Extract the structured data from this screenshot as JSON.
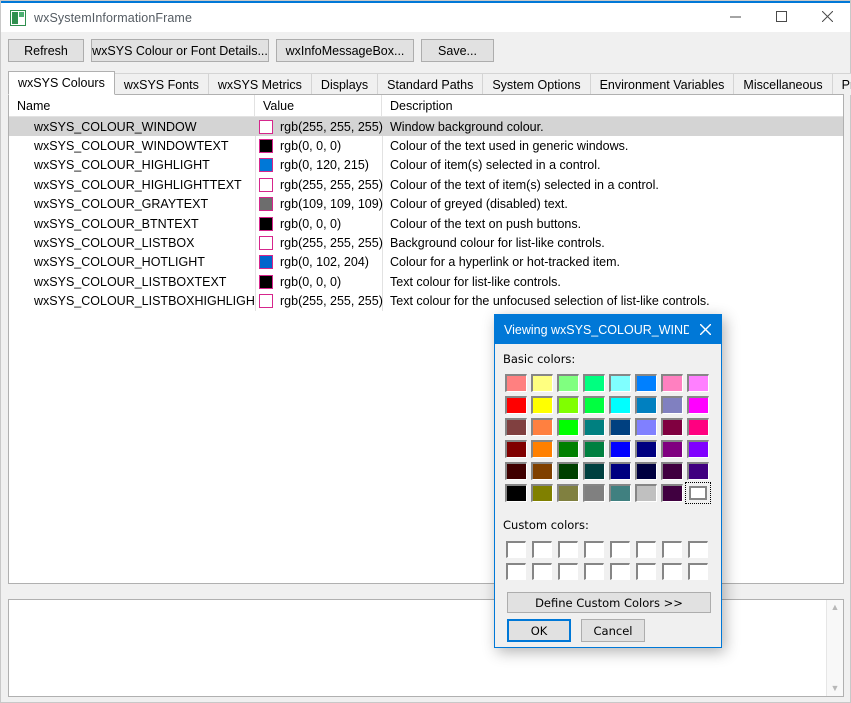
{
  "window": {
    "title": "wxSystemInformationFrame",
    "icon": "app-icon",
    "controls": {
      "minimize": "minimize",
      "maximize": "maximize",
      "close": "close"
    }
  },
  "toolbar": {
    "buttons": [
      {
        "label": "Refresh",
        "name": "refresh-button"
      },
      {
        "label": "wxSYS Colour or Font Details...",
        "name": "colour-font-details-button"
      },
      {
        "label": "wxInfoMessageBox...",
        "name": "info-message-box-button"
      },
      {
        "label": "Save...",
        "name": "save-button"
      }
    ]
  },
  "tabs": {
    "active_index": 0,
    "items": [
      {
        "label": "wxSYS Colours"
      },
      {
        "label": "wxSYS Fonts"
      },
      {
        "label": "wxSYS Metrics"
      },
      {
        "label": "Displays"
      },
      {
        "label": "Standard Paths"
      },
      {
        "label": "System Options"
      },
      {
        "label": "Environment Variables"
      },
      {
        "label": "Miscellaneous"
      },
      {
        "label": "Preprocessor Defines"
      }
    ]
  },
  "list": {
    "columns": [
      "Name",
      "Value",
      "Description"
    ],
    "selected_index": 0,
    "rows": [
      {
        "name": "wxSYS_COLOUR_WINDOW",
        "swatch": "#ffffff",
        "value": "rgb(255, 255, 255)",
        "description": "Window background colour."
      },
      {
        "name": "wxSYS_COLOUR_WINDOWTEXT",
        "swatch": "#000000",
        "value": "rgb(0, 0, 0)",
        "description": "Colour of the text used in generic windows."
      },
      {
        "name": "wxSYS_COLOUR_HIGHLIGHT",
        "swatch": "#0078d7",
        "value": "rgb(0, 120, 215)",
        "description": "Colour of item(s) selected in a control."
      },
      {
        "name": "wxSYS_COLOUR_HIGHLIGHTTEXT",
        "swatch": "#ffffff",
        "value": "rgb(255, 255, 255)",
        "description": "Colour of the text of item(s) selected in a control."
      },
      {
        "name": "wxSYS_COLOUR_GRAYTEXT",
        "swatch": "#6d6d6d",
        "value": "rgb(109, 109, 109)",
        "description": "Colour of greyed (disabled) text."
      },
      {
        "name": "wxSYS_COLOUR_BTNTEXT",
        "swatch": "#000000",
        "value": "rgb(0, 0, 0)",
        "description": "Colour of the text on push buttons."
      },
      {
        "name": "wxSYS_COLOUR_LISTBOX",
        "swatch": "#ffffff",
        "value": "rgb(255, 255, 255)",
        "description": "Background colour for list-like controls."
      },
      {
        "name": "wxSYS_COLOUR_HOTLIGHT",
        "swatch": "#0066cc",
        "value": "rgb(0, 102, 204)",
        "description": "Colour for a hyperlink or hot-tracked item."
      },
      {
        "name": "wxSYS_COLOUR_LISTBOXTEXT",
        "swatch": "#000000",
        "value": "rgb(0, 0, 0)",
        "description": "Text colour for list-like controls."
      },
      {
        "name": "wxSYS_COLOUR_LISTBOXHIGHLIGHTTEXT",
        "swatch": "#ffffff",
        "value": "rgb(255, 255, 255)",
        "description": "Text colour for the unfocused selection of list-like controls."
      }
    ]
  },
  "log": {
    "value": ""
  },
  "dialog": {
    "title": "Viewing wxSYS_COLOUR_WIND...",
    "basic_label": "Basic colors:",
    "custom_label": "Custom colors:",
    "define_custom_label": "Define Custom Colors >>",
    "ok_label": "OK",
    "cancel_label": "Cancel",
    "selected_cell": 47,
    "accent": "#0078d7",
    "basic_colors": [
      "#ff8080",
      "#ffff80",
      "#80ff80",
      "#00ff80",
      "#80ffff",
      "#0080ff",
      "#ff80c0",
      "#ff80ff",
      "#ff0000",
      "#ffff00",
      "#80ff00",
      "#00ff40",
      "#00ffff",
      "#0080c0",
      "#8080c0",
      "#ff00ff",
      "#804040",
      "#ff8040",
      "#00ff00",
      "#008080",
      "#004080",
      "#8080ff",
      "#800040",
      "#ff0080",
      "#800000",
      "#ff8000",
      "#008000",
      "#008040",
      "#0000ff",
      "#000080",
      "#800080",
      "#8000ff",
      "#400000",
      "#804000",
      "#004000",
      "#004040",
      "#000080",
      "#000040",
      "#400040",
      "#400080",
      "#000000",
      "#808000",
      "#808040",
      "#808080",
      "#408080",
      "#c0c0c0",
      "#400040",
      "#ffffff"
    ],
    "custom_colors": [
      "#ffffff",
      "#ffffff",
      "#ffffff",
      "#ffffff",
      "#ffffff",
      "#ffffff",
      "#ffffff",
      "#ffffff",
      "#ffffff",
      "#ffffff",
      "#ffffff",
      "#ffffff",
      "#ffffff",
      "#ffffff",
      "#ffffff",
      "#ffffff"
    ]
  }
}
